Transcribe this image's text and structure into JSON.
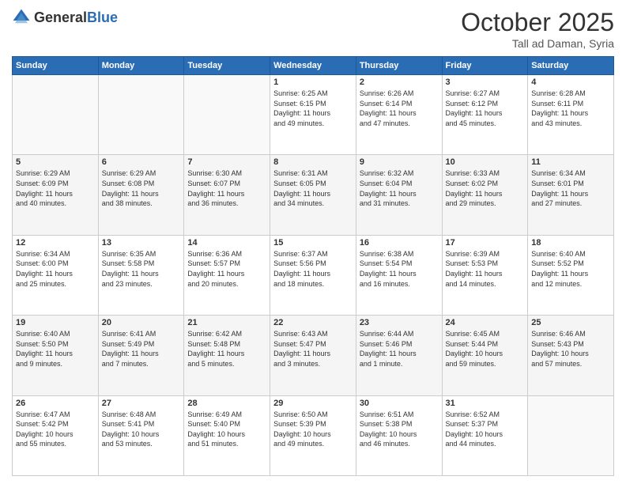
{
  "header": {
    "logo_general": "General",
    "logo_blue": "Blue",
    "month": "October 2025",
    "location": "Tall ad Daman, Syria"
  },
  "days_of_week": [
    "Sunday",
    "Monday",
    "Tuesday",
    "Wednesday",
    "Thursday",
    "Friday",
    "Saturday"
  ],
  "weeks": [
    [
      {
        "day": "",
        "info": ""
      },
      {
        "day": "",
        "info": ""
      },
      {
        "day": "",
        "info": ""
      },
      {
        "day": "1",
        "info": "Sunrise: 6:25 AM\nSunset: 6:15 PM\nDaylight: 11 hours\nand 49 minutes."
      },
      {
        "day": "2",
        "info": "Sunrise: 6:26 AM\nSunset: 6:14 PM\nDaylight: 11 hours\nand 47 minutes."
      },
      {
        "day": "3",
        "info": "Sunrise: 6:27 AM\nSunset: 6:12 PM\nDaylight: 11 hours\nand 45 minutes."
      },
      {
        "day": "4",
        "info": "Sunrise: 6:28 AM\nSunset: 6:11 PM\nDaylight: 11 hours\nand 43 minutes."
      }
    ],
    [
      {
        "day": "5",
        "info": "Sunrise: 6:29 AM\nSunset: 6:09 PM\nDaylight: 11 hours\nand 40 minutes."
      },
      {
        "day": "6",
        "info": "Sunrise: 6:29 AM\nSunset: 6:08 PM\nDaylight: 11 hours\nand 38 minutes."
      },
      {
        "day": "7",
        "info": "Sunrise: 6:30 AM\nSunset: 6:07 PM\nDaylight: 11 hours\nand 36 minutes."
      },
      {
        "day": "8",
        "info": "Sunrise: 6:31 AM\nSunset: 6:05 PM\nDaylight: 11 hours\nand 34 minutes."
      },
      {
        "day": "9",
        "info": "Sunrise: 6:32 AM\nSunset: 6:04 PM\nDaylight: 11 hours\nand 31 minutes."
      },
      {
        "day": "10",
        "info": "Sunrise: 6:33 AM\nSunset: 6:02 PM\nDaylight: 11 hours\nand 29 minutes."
      },
      {
        "day": "11",
        "info": "Sunrise: 6:34 AM\nSunset: 6:01 PM\nDaylight: 11 hours\nand 27 minutes."
      }
    ],
    [
      {
        "day": "12",
        "info": "Sunrise: 6:34 AM\nSunset: 6:00 PM\nDaylight: 11 hours\nand 25 minutes."
      },
      {
        "day": "13",
        "info": "Sunrise: 6:35 AM\nSunset: 5:58 PM\nDaylight: 11 hours\nand 23 minutes."
      },
      {
        "day": "14",
        "info": "Sunrise: 6:36 AM\nSunset: 5:57 PM\nDaylight: 11 hours\nand 20 minutes."
      },
      {
        "day": "15",
        "info": "Sunrise: 6:37 AM\nSunset: 5:56 PM\nDaylight: 11 hours\nand 18 minutes."
      },
      {
        "day": "16",
        "info": "Sunrise: 6:38 AM\nSunset: 5:54 PM\nDaylight: 11 hours\nand 16 minutes."
      },
      {
        "day": "17",
        "info": "Sunrise: 6:39 AM\nSunset: 5:53 PM\nDaylight: 11 hours\nand 14 minutes."
      },
      {
        "day": "18",
        "info": "Sunrise: 6:40 AM\nSunset: 5:52 PM\nDaylight: 11 hours\nand 12 minutes."
      }
    ],
    [
      {
        "day": "19",
        "info": "Sunrise: 6:40 AM\nSunset: 5:50 PM\nDaylight: 11 hours\nand 9 minutes."
      },
      {
        "day": "20",
        "info": "Sunrise: 6:41 AM\nSunset: 5:49 PM\nDaylight: 11 hours\nand 7 minutes."
      },
      {
        "day": "21",
        "info": "Sunrise: 6:42 AM\nSunset: 5:48 PM\nDaylight: 11 hours\nand 5 minutes."
      },
      {
        "day": "22",
        "info": "Sunrise: 6:43 AM\nSunset: 5:47 PM\nDaylight: 11 hours\nand 3 minutes."
      },
      {
        "day": "23",
        "info": "Sunrise: 6:44 AM\nSunset: 5:46 PM\nDaylight: 11 hours\nand 1 minute."
      },
      {
        "day": "24",
        "info": "Sunrise: 6:45 AM\nSunset: 5:44 PM\nDaylight: 10 hours\nand 59 minutes."
      },
      {
        "day": "25",
        "info": "Sunrise: 6:46 AM\nSunset: 5:43 PM\nDaylight: 10 hours\nand 57 minutes."
      }
    ],
    [
      {
        "day": "26",
        "info": "Sunrise: 6:47 AM\nSunset: 5:42 PM\nDaylight: 10 hours\nand 55 minutes."
      },
      {
        "day": "27",
        "info": "Sunrise: 6:48 AM\nSunset: 5:41 PM\nDaylight: 10 hours\nand 53 minutes."
      },
      {
        "day": "28",
        "info": "Sunrise: 6:49 AM\nSunset: 5:40 PM\nDaylight: 10 hours\nand 51 minutes."
      },
      {
        "day": "29",
        "info": "Sunrise: 6:50 AM\nSunset: 5:39 PM\nDaylight: 10 hours\nand 49 minutes."
      },
      {
        "day": "30",
        "info": "Sunrise: 6:51 AM\nSunset: 5:38 PM\nDaylight: 10 hours\nand 46 minutes."
      },
      {
        "day": "31",
        "info": "Sunrise: 6:52 AM\nSunset: 5:37 PM\nDaylight: 10 hours\nand 44 minutes."
      },
      {
        "day": "",
        "info": ""
      }
    ]
  ]
}
